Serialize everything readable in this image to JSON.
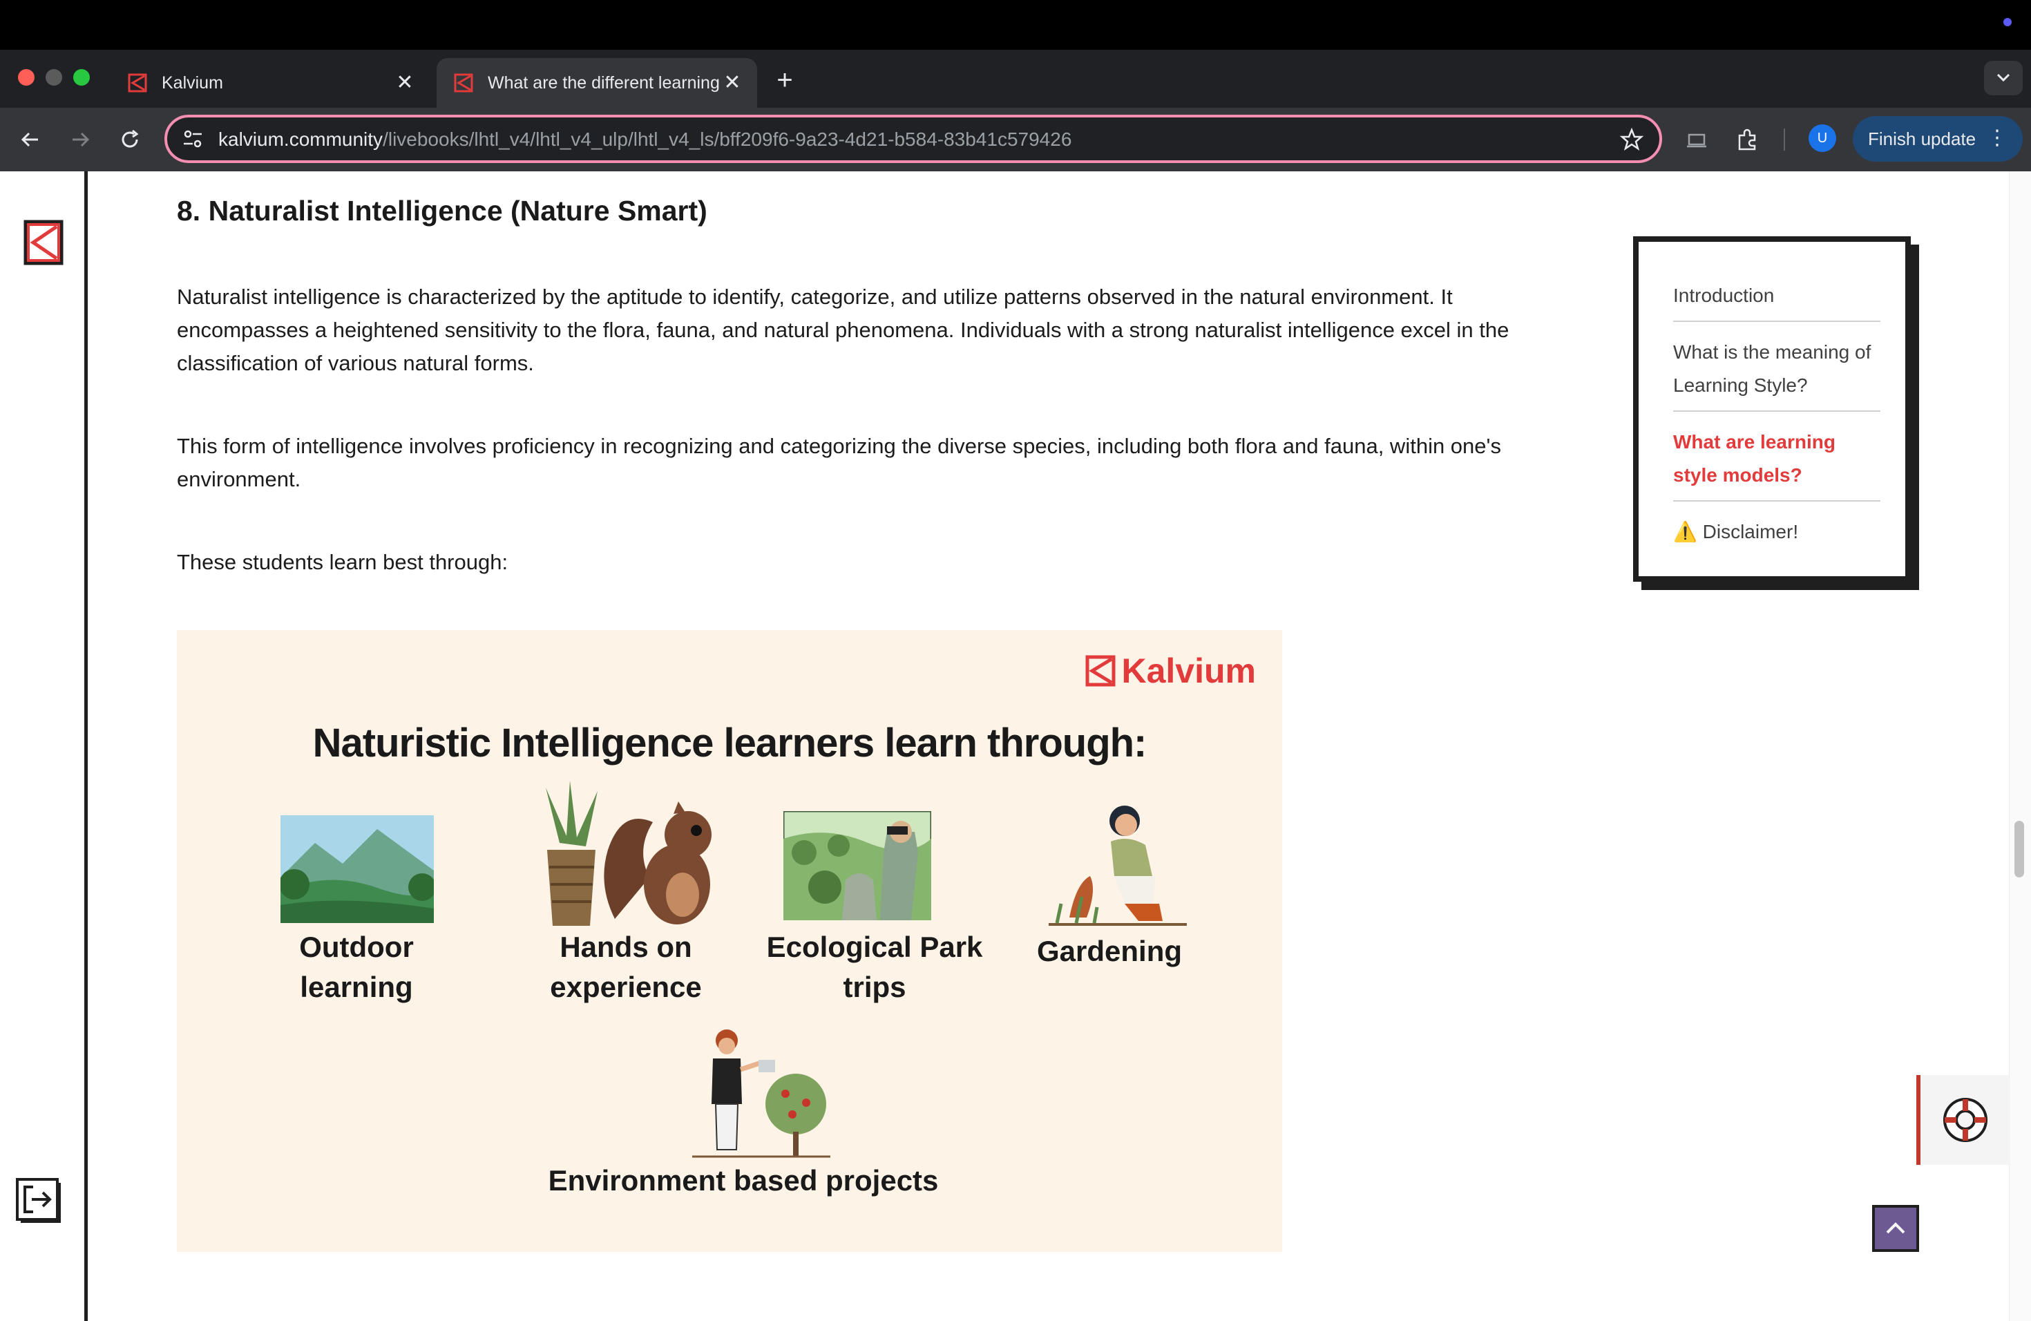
{
  "browser": {
    "tabs": [
      {
        "label": "Kalvium",
        "close": "✕"
      },
      {
        "label": "What are the different learning",
        "close": "✕"
      }
    ],
    "new_tab": "+",
    "url_host": "kalvium.community",
    "url_path": "/livebooks/lhtl_v4/lhtl_v4_ulp/lhtl_v4_ls/bff209f6-9a23-4d21-b584-83b41c579426",
    "profile_initial": "U",
    "finish_update": "Finish update",
    "kebab": "⋮"
  },
  "article": {
    "heading": "8. Naturalist Intelligence (Nature Smart)",
    "paragraphs": [
      "Naturalist intelligence is characterized by the aptitude to identify, categorize, and utilize patterns observed in the natural environment. It encompasses a heightened sensitivity to the flora, fauna, and natural phenomena. Individuals with a strong naturalist intelligence excel in the classification of various natural forms.",
      "This form of intelligence involves proficiency in recognizing and categorizing the diverse species, including both flora and fauna, within one's environment.",
      "These students learn best through:"
    ]
  },
  "infographic": {
    "brand": "Kalvium",
    "title": "Naturistic Intelligence learners learn through:",
    "items": [
      {
        "line1": "Outdoor",
        "line2": "learning"
      },
      {
        "line1": "Hands on",
        "line2": "experience"
      },
      {
        "line1": "Ecological Park",
        "line2": "trips"
      },
      {
        "line1": "Gardening",
        "line2": ""
      },
      {
        "line1": "Environment based projects",
        "line2": ""
      }
    ]
  },
  "toc": {
    "items": [
      "Introduction",
      "What is the meaning of Learning Style?",
      "What are learning style models?",
      "⚠️ Disclaimer!"
    ],
    "active_index": 2
  },
  "colors": {
    "accent": "#e23b3b",
    "infographic_bg": "#fdf3e7",
    "update_button": "#1e4876"
  }
}
